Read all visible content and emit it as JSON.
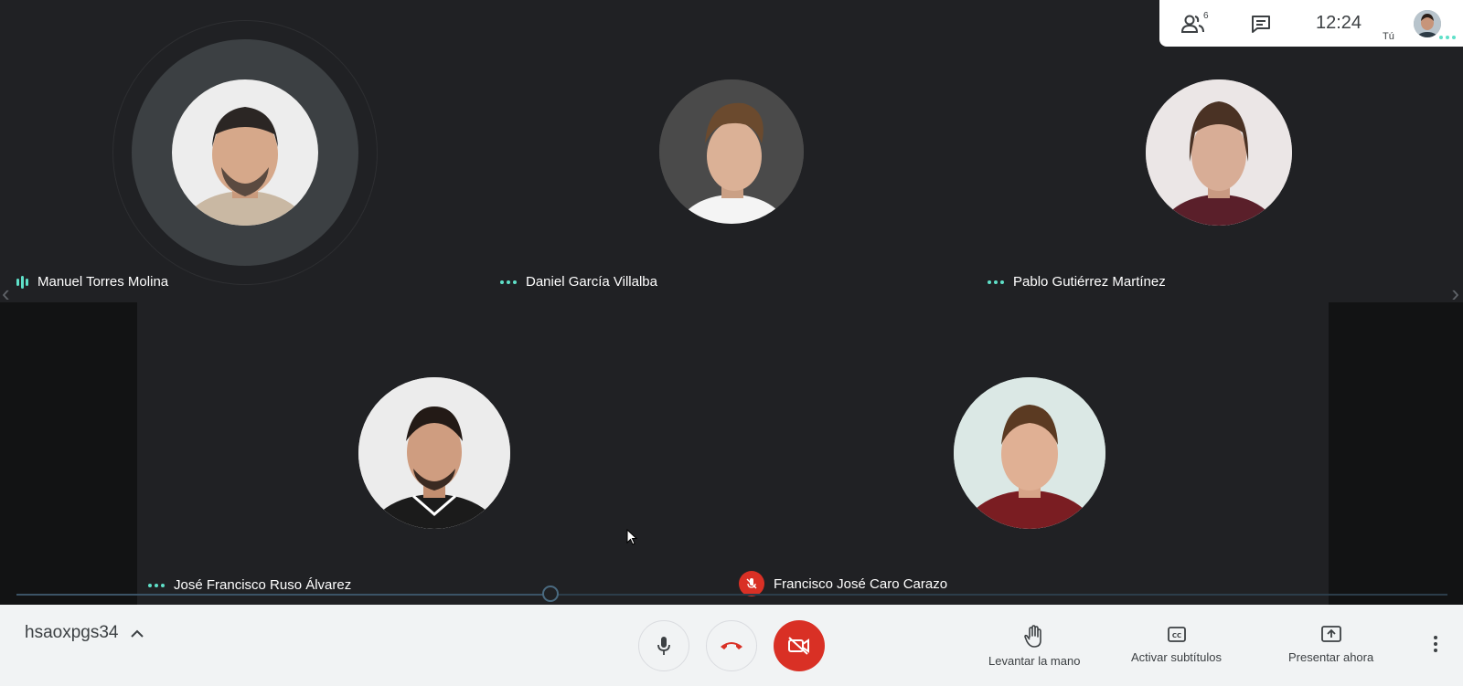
{
  "topbar": {
    "participants_icon": "people-icon",
    "participants_count": "6",
    "chat_icon": "chat-icon",
    "time": "12:24",
    "self_label": "Tú"
  },
  "participants": [
    {
      "name": "Manuel Torres Molina",
      "status": "speaking"
    },
    {
      "name": "Daniel García Villalba",
      "status": "dots"
    },
    {
      "name": "Pablo Gutiérrez Martínez",
      "status": "dots"
    },
    {
      "name": "José Francisco Ruso Álvarez",
      "status": "dots"
    },
    {
      "name": "Francisco José Caro Carazo",
      "status": "muted"
    }
  ],
  "bottombar": {
    "meeting_code": "hsaoxpgs34",
    "raise_hand_label": "Levantar la mano",
    "captions_label": "Activar subtítulos",
    "present_label": "Presentar ahora"
  },
  "colors": {
    "accent": "#5fe0c8",
    "danger": "#d93025",
    "stage": "#202124",
    "bar": "#f1f3f4"
  }
}
